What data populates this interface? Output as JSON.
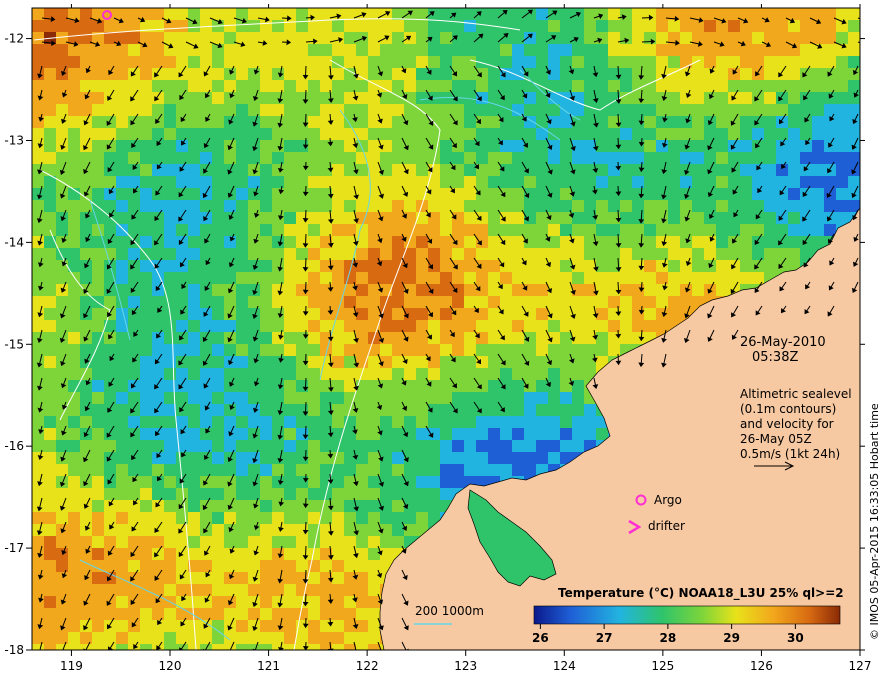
{
  "map": {
    "lon_ticks": [
      "119",
      "120",
      "121",
      "122",
      "123",
      "124",
      "125",
      "126",
      "127"
    ],
    "lat_ticks": [
      "-12",
      "-13",
      "-14",
      "-15",
      "-16",
      "-17",
      "-18"
    ],
    "lon_range": [
      118.6,
      127.0
    ],
    "lat_range": [
      -11.7,
      -18.0
    ]
  },
  "annotations": {
    "date": "26-May-2010",
    "time": "05:38Z",
    "altimetry_lines": [
      "Altimetric sealevel",
      "(0.1m contours)",
      "and velocity for",
      "26-May 05Z",
      "0.5m/s (1kt 24h)"
    ],
    "argo_label": "Argo",
    "drifter_label": "drifter",
    "bathymetry_label": "200  1000m",
    "credit": "© IMOS 05-Apr-2015 16:33:05 Hobart time"
  },
  "colorbar": {
    "title": "Temperature (°C) NOAA18_L3U 25% ql>=2",
    "ticks": [
      "26",
      "27",
      "28",
      "29",
      "30"
    ],
    "range": [
      25.9,
      30.7
    ],
    "colors": [
      "#0a1a8c",
      "#1f5fd6",
      "#22b4e0",
      "#2fc46a",
      "#7ed53a",
      "#e8e21a",
      "#f2a81c",
      "#d86a12",
      "#8a2a06"
    ]
  },
  "colors": {
    "land": "#f7c9a2",
    "argo_marker": "#ff30d2",
    "drifter_marker": "#ff30d2",
    "contour": "#ffffff",
    "bathymetry": "#67d6e8"
  }
}
